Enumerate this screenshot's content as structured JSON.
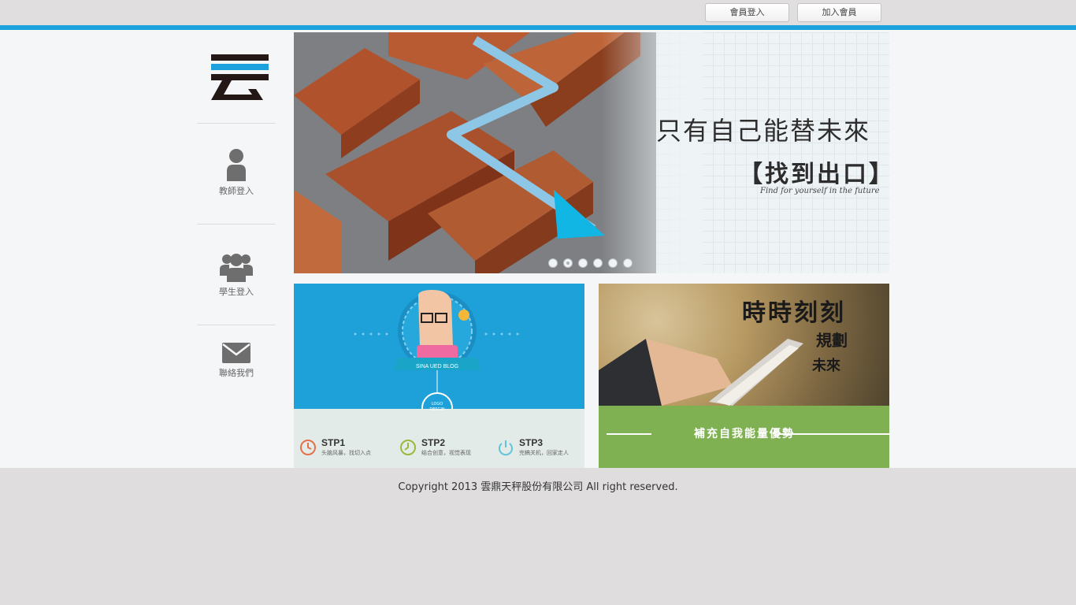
{
  "header": {
    "member_login": "會員登入",
    "join_member": "加入會員",
    "accent_color": "#1ba1dc"
  },
  "sidebar": {
    "logo_icon": "cloud-char-logo",
    "items": [
      {
        "label": "教師登入",
        "icon": "person-icon"
      },
      {
        "label": "學生登入",
        "icon": "group-icon"
      },
      {
        "label": "聯絡我們",
        "icon": "mail-icon"
      }
    ]
  },
  "banner": {
    "title": "只有自己能替未來",
    "subtitle": "【找到出口】",
    "english": "Find for yourself in the future",
    "slide_count": 6,
    "active_slide": 2
  },
  "promo_left": {
    "badge": "SINA UED BLOG",
    "logo_text": "LOGO DESGIN",
    "steps": [
      {
        "title": "STP1",
        "desc": "头脑风暴，找切入点"
      },
      {
        "title": "STP2",
        "desc": "结合创意，视觉表现"
      },
      {
        "title": "STP3",
        "desc": "完稿关机，回家走人"
      }
    ]
  },
  "promo_right": {
    "line1": "時時刻刻",
    "line2": "規劃",
    "line3": "未來",
    "caption": "補充自我能量優勢"
  },
  "footer": {
    "copyright": "Copyright 2013 雲鼎天秤股份有限公司 All right reserved."
  }
}
